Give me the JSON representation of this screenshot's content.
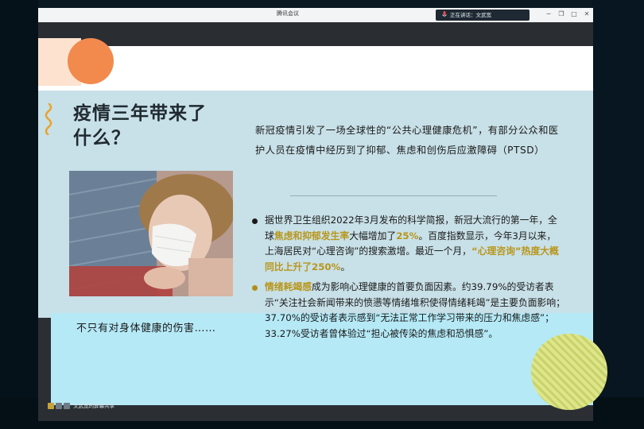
{
  "window": {
    "title": "腾讯会议",
    "speaking_label": "正在讲话：文武宽",
    "min_symbol": "─",
    "restore_symbol": "❐",
    "max_symbol": "□",
    "close_symbol": "✕"
  },
  "slide": {
    "heading_line1": "疫情三年带来了",
    "heading_line2": "什么？",
    "intro": "新冠疫情引发了一场全球性的“公共心理健康危机”，有部分公众和医护人员在疫情中经历到了抑郁、焦虑和创伤后应激障碍（PTSD）",
    "bullet1": {
      "t1": "据世界卫生组织2022年3月发布的科学简报，新冠大流行的第一年，全球",
      "h1": "焦虑和抑郁发生率",
      "t2": "大幅增加了",
      "h2": "25%",
      "t3": "。百度指数显示，今年3月以来，上海居民对“心理咨询”的搜索激增。最近一个月，",
      "h3": "“心理咨询”热度大概同比上升了250%",
      "t4": "。"
    },
    "bullet2": {
      "h1": "情绪耗竭感",
      "t1": "成为影响心理健康的首要负面因素。约39.79%的受访者表示“关注社会新闻带来的愤懑等情绪堆积使得情绪耗竭”是主要负面影响；37.70%的受访者表示感到“无法正常工作学习带来的压力和焦虑感”；33.27%受访者曾体验过“担心被传染的焦虑和恐惧感”。"
    },
    "left_caption": "不只有对身体健康的伤害……"
  },
  "taskbar": {
    "label": "文武宽的屏幕共享"
  },
  "colors": {
    "slide_bg": "#c8e0e7",
    "accent_gold": "#b8961b",
    "orange": "#f28a4e"
  }
}
